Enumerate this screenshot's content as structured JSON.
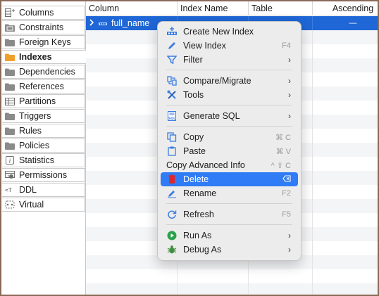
{
  "sidebar": {
    "items": [
      {
        "label": "Columns",
        "icon": "columns-icon"
      },
      {
        "label": "Constraints",
        "icon": "folder-icon"
      },
      {
        "label": "Foreign Keys",
        "icon": "folder-icon"
      },
      {
        "label": "Indexes",
        "icon": "folder-orange-icon"
      },
      {
        "label": "Dependencies",
        "icon": "folder-icon"
      },
      {
        "label": "References",
        "icon": "folder-icon"
      },
      {
        "label": "Partitions",
        "icon": "partitions-icon"
      },
      {
        "label": "Triggers",
        "icon": "folder-icon"
      },
      {
        "label": "Rules",
        "icon": "folder-icon"
      },
      {
        "label": "Policies",
        "icon": "folder-icon"
      },
      {
        "label": "Statistics",
        "icon": "statistics-icon"
      },
      {
        "label": "Permissions",
        "icon": "permissions-icon"
      },
      {
        "label": "DDL",
        "icon": "ddl-icon"
      },
      {
        "label": "Virtual",
        "icon": "virtual-icon"
      }
    ],
    "active_index": 3
  },
  "table": {
    "headers": [
      "Column",
      "Index Name",
      "Table",
      "Ascending"
    ],
    "selected_row": {
      "column": "full_name",
      "ascending": "—"
    }
  },
  "context_menu": {
    "items": [
      {
        "label": "Create New Index",
        "icon": "create-index-icon",
        "shortcut": "",
        "submenu": false
      },
      {
        "label": "View Index",
        "icon": "pencil-icon",
        "shortcut": "F4",
        "submenu": false
      },
      {
        "label": "Filter",
        "icon": "filter-icon",
        "shortcut": "",
        "submenu": true
      },
      {
        "sep": true
      },
      {
        "label": "Compare/Migrate",
        "icon": "compare-icon",
        "shortcut": "",
        "submenu": true
      },
      {
        "label": "Tools",
        "icon": "tools-icon",
        "shortcut": "",
        "submenu": true
      },
      {
        "sep": true
      },
      {
        "label": "Generate SQL",
        "icon": "sql-icon",
        "shortcut": "",
        "submenu": true
      },
      {
        "sep": true
      },
      {
        "label": "Copy",
        "icon": "copy-icon",
        "shortcut": "⌘ C",
        "submenu": false
      },
      {
        "label": "Paste",
        "icon": "paste-icon",
        "shortcut": "⌘ V",
        "submenu": false
      },
      {
        "label": "Copy Advanced Info",
        "icon": "",
        "shortcut": "^ ⇧ C",
        "submenu": false
      },
      {
        "label": "Delete",
        "icon": "delete-icon",
        "shortcut": "",
        "submenu": false,
        "highlighted": true
      },
      {
        "label": "Rename",
        "icon": "rename-icon",
        "shortcut": "F2",
        "submenu": false
      },
      {
        "sep": true
      },
      {
        "label": "Refresh",
        "icon": "refresh-icon",
        "shortcut": "F5",
        "submenu": false
      },
      {
        "sep": true
      },
      {
        "label": "Run As",
        "icon": "run-icon",
        "shortcut": "",
        "submenu": true
      },
      {
        "label": "Debug As",
        "icon": "debug-icon",
        "shortcut": "",
        "submenu": true
      }
    ]
  },
  "colors": {
    "selection": "#1f66d6",
    "menu_highlight": "#2f7cf6",
    "frame_border": "#8a6a57",
    "folder_gray": "#8a8a8a",
    "folder_orange": "#f0a02a"
  }
}
